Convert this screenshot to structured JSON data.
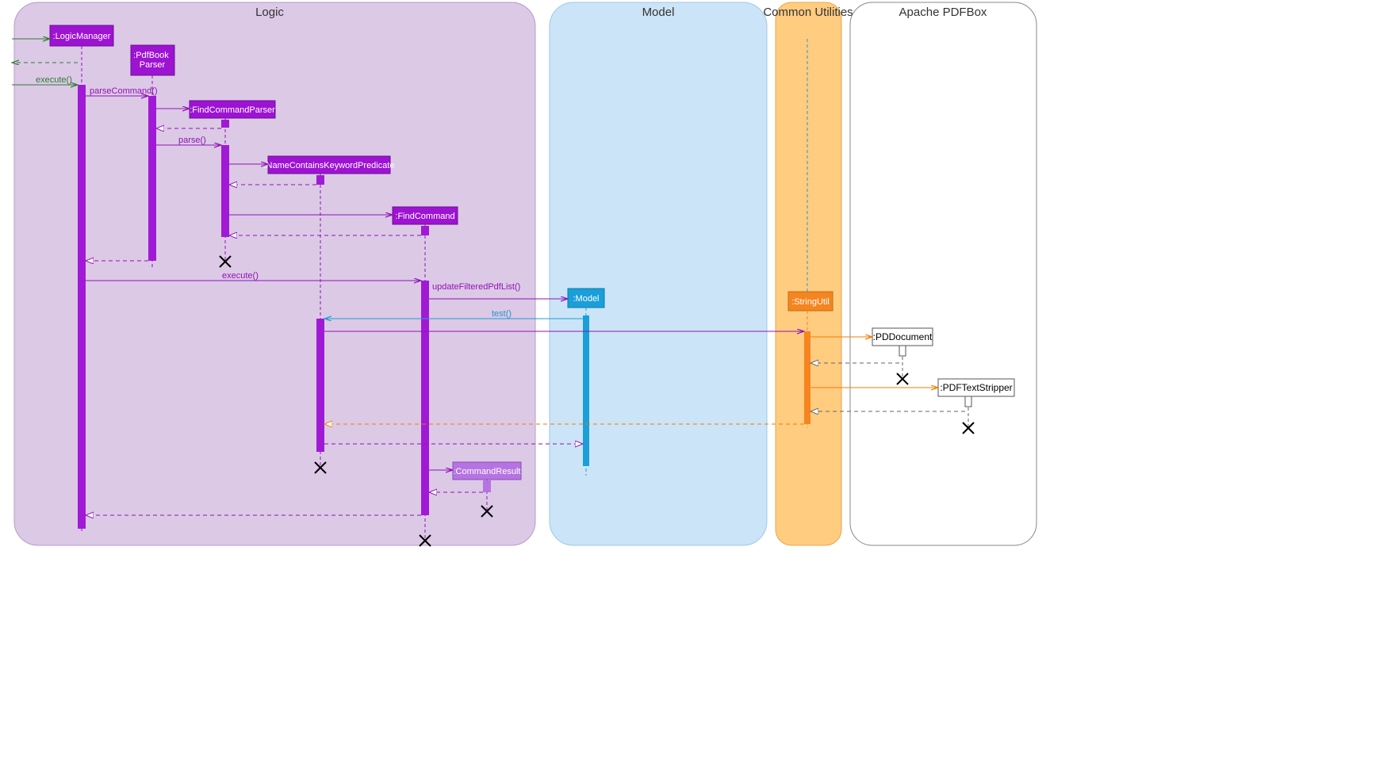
{
  "frames": {
    "logic": "Logic",
    "model": "Model",
    "common": "Common Utilities",
    "pdfbox": "Apache PDFBox"
  },
  "lifelines": {
    "logicManager": ":LogicManager",
    "pdfBookParser": ":PdfBook Parser",
    "findCommandParser": ":FindCommandParser",
    "predicate": ":NameContainsKeywordPredicate",
    "findCommand": ":FindCommand",
    "commandResult": ":CommandResult",
    "model": ":Model",
    "stringUtil": ":StringUtil",
    "pddocument": ":PDDocument",
    "pdftextstripper": ":PDFTextStripper"
  },
  "messages": {
    "execute": "execute()",
    "parseCommand": "parseCommand()",
    "parse": "parse()",
    "execute2": "execute()",
    "updateFilteredPdfList": "updateFilteredPdfList()",
    "test": "test()"
  },
  "colors": {
    "logicFrame": "#dcc9e6",
    "modelFrame": "#cce4f7",
    "commonFrame": "#ffcc80",
    "purpleBox": "#9d13d2",
    "purpleBorder": "#6b0f93",
    "lightPurpleBox": "#b574e1",
    "blueBox": "#1a9fd8",
    "orangeBox": "#f5851f",
    "orangeBorder": "#c76a15",
    "activation": "#a01ad6",
    "blueAct": "#1a9fd8",
    "orangeAct": "#f5851f"
  }
}
